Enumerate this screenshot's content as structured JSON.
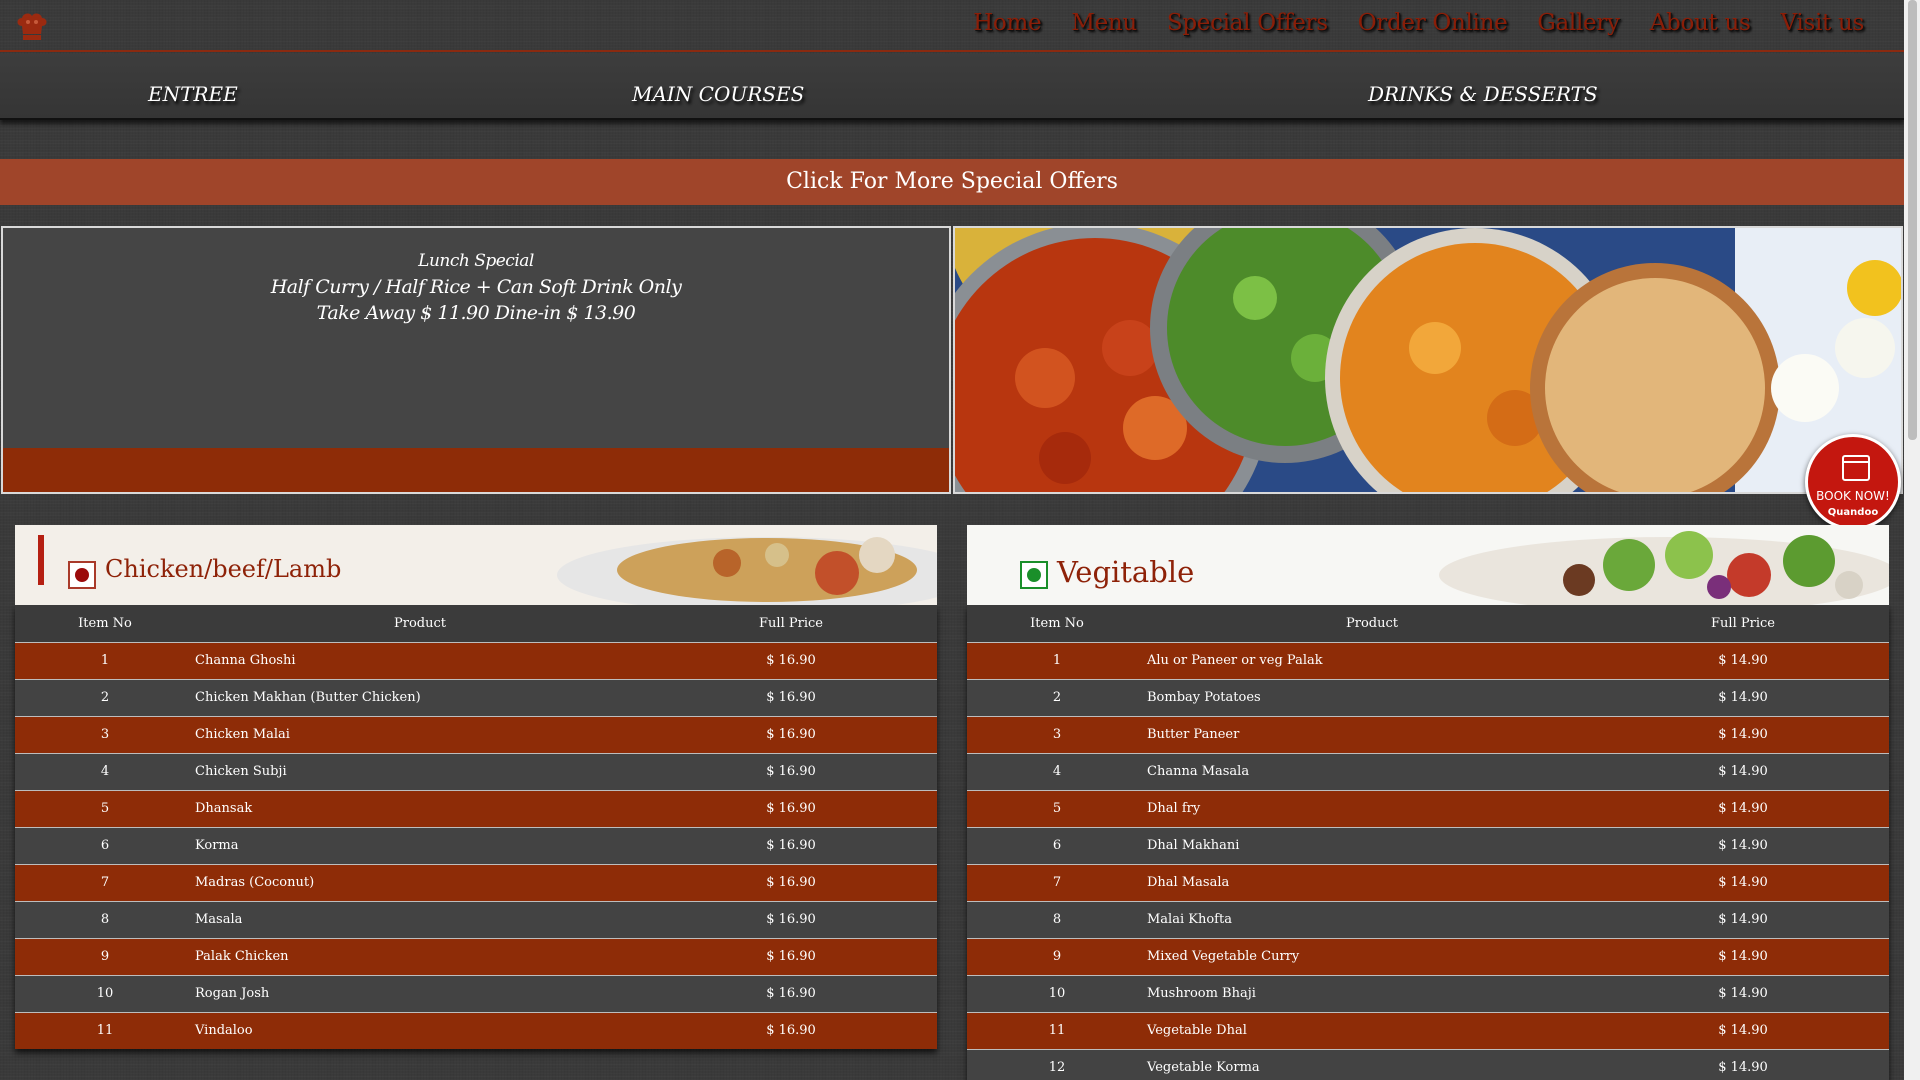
{
  "nav": [
    "Home",
    "Menu",
    "Special Offers",
    "Order Online",
    "Gallery",
    "About us",
    "Visit us"
  ],
  "submenu": [
    "ENTREE",
    "MAIN COURSES",
    "DRINKS & DESSERTS"
  ],
  "offers_label": "Click For More Special Offers",
  "promo": {
    "line1": "Lunch Special",
    "line2": "Half Curry / Half Rice + Can Soft Drink Only",
    "line3": "Take Away $ 11.90 Dine-in $ 13.90"
  },
  "book_now": {
    "label": "BOOK NOW!",
    "brand": "Quandoo"
  },
  "colors": {
    "accent": "#8e2c07",
    "offers_bar": "#a0452a",
    "nonveg_dot": "#9b0b0b",
    "veg_dot": "#1a8f2a"
  },
  "cards": [
    {
      "title": "Chicken/beef/Lamb",
      "headers": [
        "Item No",
        "Product",
        "Full Price"
      ],
      "rows": [
        [
          "1",
          "Channa Ghoshi",
          "$ 16.90"
        ],
        [
          "2",
          "Chicken Makhan (Butter Chicken)",
          "$ 16.90"
        ],
        [
          "3",
          "Chicken Malai",
          "$ 16.90"
        ],
        [
          "4",
          "Chicken Subji",
          "$ 16.90"
        ],
        [
          "5",
          "Dhansak",
          "$ 16.90"
        ],
        [
          "6",
          "Korma",
          "$ 16.90"
        ],
        [
          "7",
          "Madras (Coconut)",
          "$ 16.90"
        ],
        [
          "8",
          "Masala",
          "$ 16.90"
        ],
        [
          "9",
          "Palak Chicken",
          "$ 16.90"
        ],
        [
          "10",
          "Rogan Josh",
          "$ 16.90"
        ],
        [
          "11",
          "Vindaloo",
          "$ 16.90"
        ]
      ]
    },
    {
      "title": "Vegitable",
      "headers": [
        "Item No",
        "Product",
        "Full Price"
      ],
      "rows": [
        [
          "1",
          "Alu or Paneer or veg Palak",
          "$ 14.90"
        ],
        [
          "2",
          "Bombay Potatoes",
          "$ 14.90"
        ],
        [
          "3",
          "Butter Paneer",
          "$ 14.90"
        ],
        [
          "4",
          "Channa Masala",
          "$ 14.90"
        ],
        [
          "5",
          "Dhal fry",
          "$ 14.90"
        ],
        [
          "6",
          "Dhal Makhani",
          "$ 14.90"
        ],
        [
          "7",
          "Dhal Masala",
          "$ 14.90"
        ],
        [
          "8",
          "Malai Khofta",
          "$ 14.90"
        ],
        [
          "9",
          "Mixed Vegetable Curry",
          "$ 14.90"
        ],
        [
          "10",
          "Mushroom Bhaji",
          "$ 14.90"
        ],
        [
          "11",
          "Vegetable Dhal",
          "$ 14.90"
        ],
        [
          "12",
          "Vegetable Korma",
          "$ 14.90"
        ]
      ]
    }
  ]
}
